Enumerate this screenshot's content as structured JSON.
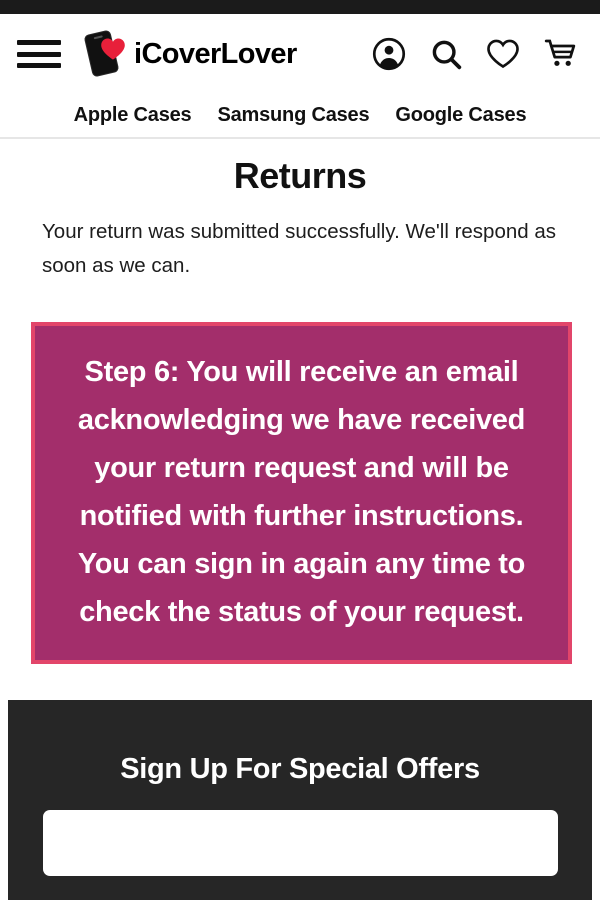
{
  "topbar": {
    "present": true,
    "color": "#1b1b1b"
  },
  "header": {
    "menu_icon": "hamburger-menu-icon",
    "logo": {
      "brand_text": "iCoverLover",
      "phone_icon": "phone-icon",
      "heart_icon": "heart-icon",
      "heart_color": "#e8203a"
    },
    "icons": [
      {
        "name": "account-icon",
        "label": "Account"
      },
      {
        "name": "search-icon",
        "label": "Search"
      },
      {
        "name": "wishlist-heart-icon",
        "label": "Wishlist"
      },
      {
        "name": "shopping-cart-icon",
        "label": "Cart"
      }
    ]
  },
  "nav": {
    "links": [
      {
        "label": "Apple Cases"
      },
      {
        "label": "Samsung Cases"
      },
      {
        "label": "Google Cases"
      }
    ]
  },
  "main": {
    "title": "Returns",
    "intro": "Your return was submitted successfully. We'll respond as soon as we can.",
    "notice": {
      "text": "Step 6: You will receive an email acknowledging we have received your return request and will be notified with further instructions. You can sign in again any time to check the status of your request.",
      "background_color": "#a32e6b",
      "border_color": "#e2456a",
      "text_color": "#ffffff"
    }
  },
  "footer": {
    "signup_title": "Sign Up For Special Offers",
    "email_value": "",
    "email_placeholder": "",
    "background_color": "#262626"
  }
}
